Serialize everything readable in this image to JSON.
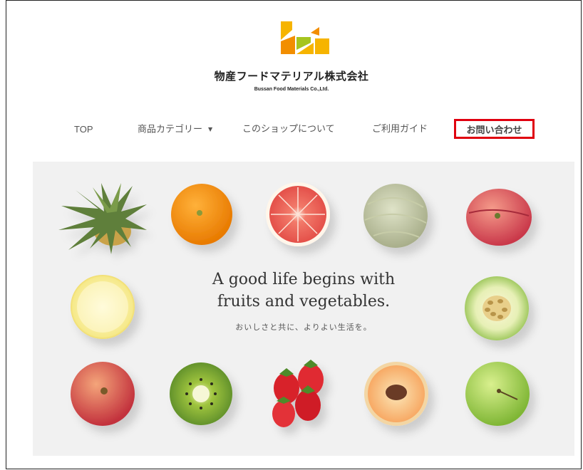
{
  "brand": {
    "name_jp": "物産フードマテリアル株式会社",
    "name_en": "Bussan Food Materials Co.,Ltd.",
    "logo_colors": [
      "#f6b400",
      "#f28e00",
      "#a6c51f"
    ]
  },
  "nav": {
    "items": [
      {
        "label": "TOP"
      },
      {
        "label": "商品カテゴリー",
        "icon": "caret-down-icon"
      },
      {
        "label": "このショップについて"
      },
      {
        "label": "ご利用ガイド"
      },
      {
        "label": "お問い合わせ",
        "highlight_color": "#e0000f"
      }
    ]
  },
  "hero": {
    "title_line1": "A good life begins with",
    "title_line2": "fruits and vegetables.",
    "subtitle": "おいしさと共に、よりよい生活を。",
    "background": "#f1f1f1",
    "fruits": [
      "pineapple",
      "orange",
      "grapefruit",
      "melon",
      "peach",
      "lemon",
      "honeydew-melon",
      "apple",
      "kiwi",
      "strawberries",
      "white-peach",
      "green-apple"
    ]
  }
}
